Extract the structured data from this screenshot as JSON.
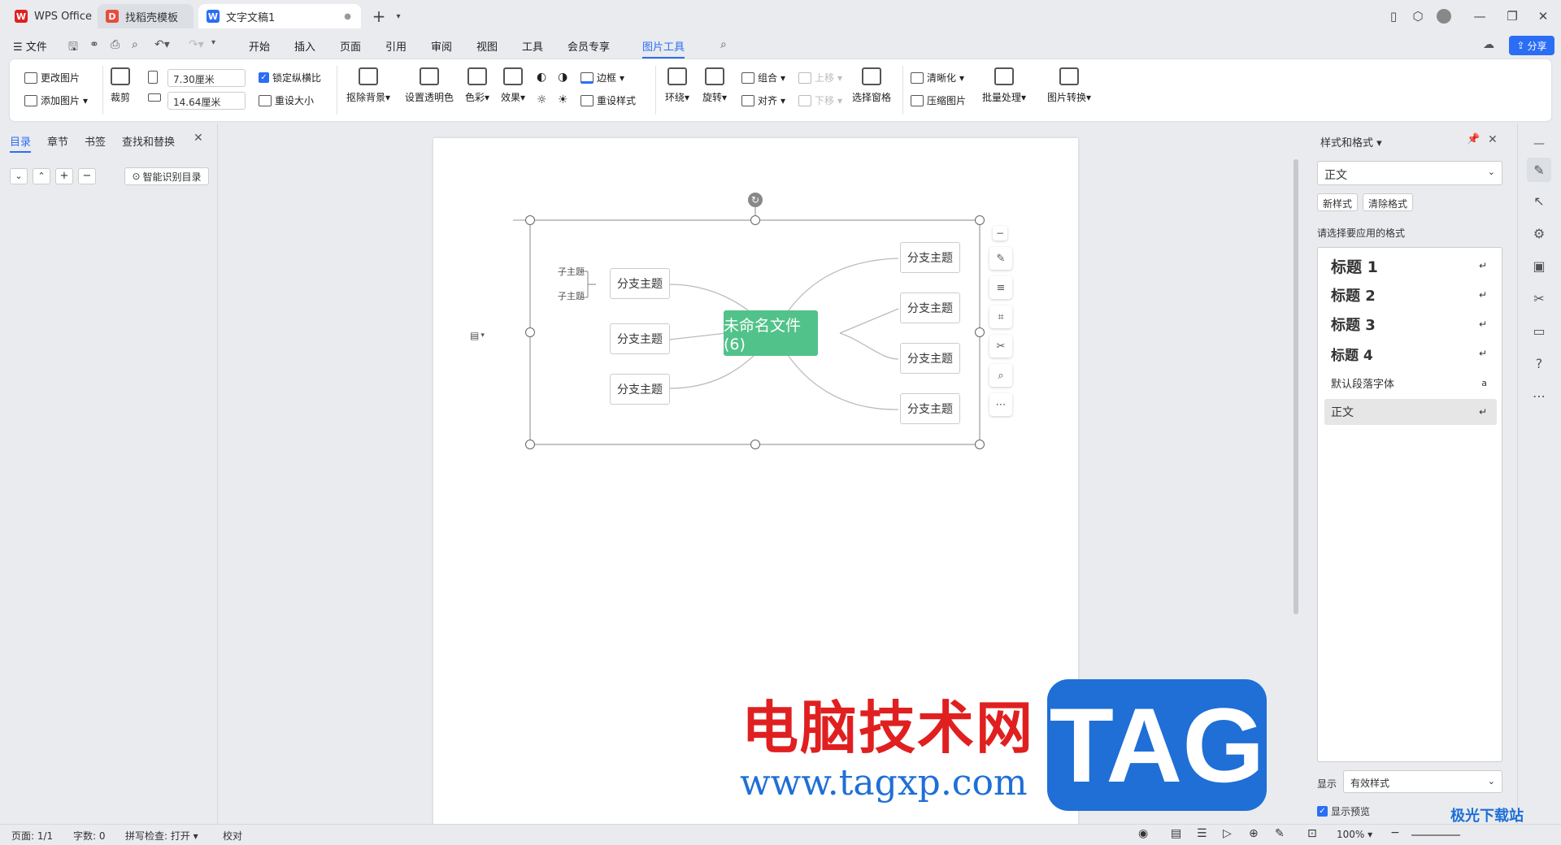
{
  "tabs": [
    {
      "label": "WPS Office",
      "icon": "wps-logo-icon"
    },
    {
      "label": "找稻壳模板",
      "icon": "docer-icon"
    },
    {
      "label": "文字文稿1",
      "icon": "word-doc-icon"
    }
  ],
  "titlebar": {
    "new_tab": "+",
    "share_label": "分享"
  },
  "menu": {
    "file": "文件",
    "items": [
      "开始",
      "插入",
      "页面",
      "引用",
      "审阅",
      "视图",
      "工具",
      "会员专享",
      "图片工具"
    ],
    "active": "图片工具"
  },
  "ribbon": {
    "change_pic": "更改图片",
    "add_pic": "添加图片",
    "crop": "裁剪",
    "width_value": "7.30厘米",
    "height_value": "14.64厘米",
    "lock_ratio": "锁定纵横比",
    "reset_size": "重设大小",
    "remove_bg": "抠除背景",
    "set_transparent": "设置透明色",
    "color": "色彩",
    "effect": "效果",
    "border": "边框",
    "reset_style": "重设样式",
    "wrap": "环绕",
    "rotate": "旋转",
    "group": "组合",
    "align": "对齐",
    "move_up": "上移",
    "move_down": "下移",
    "select_pane": "选择窗格",
    "sharpen": "清晰化",
    "compress": "压缩图片",
    "batch": "批量处理",
    "convert": "图片转换"
  },
  "left_pane": {
    "tabs": [
      "目录",
      "章节",
      "书签",
      "查找和替换"
    ],
    "smart_toc": "智能识别目录"
  },
  "mindmap": {
    "center": "未命名文件(6)",
    "branch": "分支主题",
    "sub": "子主题"
  },
  "right_pane": {
    "title": "样式和格式",
    "current_style": "正文",
    "new_style": "新样式",
    "clear_format": "清除格式",
    "prompt": "请选择要应用的格式",
    "styles": [
      "标题 1",
      "标题 2",
      "标题 3",
      "标题 4",
      "默认段落字体",
      "正文"
    ],
    "show_label": "显示",
    "show_value": "有效样式",
    "preview_label": "显示预览"
  },
  "status": {
    "page": "页面: 1/1",
    "words": "字数: 0",
    "spell": "拼写检查: 打开",
    "proof": "校对",
    "zoom": "100%"
  },
  "watermark": {
    "site_name": "电脑技术网",
    "url": "www.tagxp.com",
    "badge": "TAG",
    "corner": "极光下载站"
  },
  "colors": {
    "accent": "#2b6ef5",
    "node_center": "#52c28b",
    "watermark_red": "#e02020",
    "watermark_blue": "#1f6fd6"
  }
}
